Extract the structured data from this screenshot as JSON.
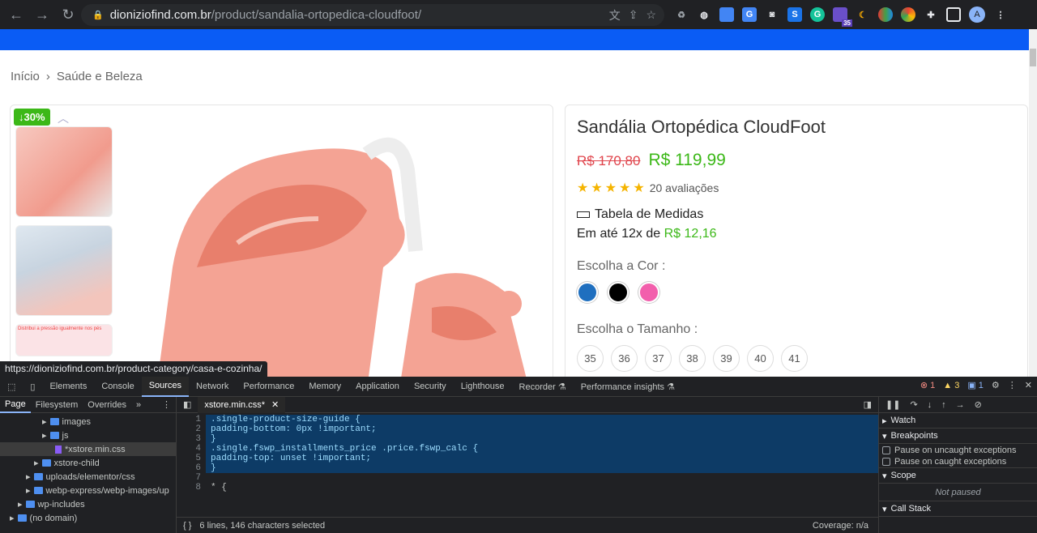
{
  "browser": {
    "url_host": "dioniziofind.com.br",
    "url_path": "/product/sandalia-ortopedica-cloudfoot/",
    "ext_badge": "35",
    "avatar_letter": "A"
  },
  "breadcrumb": {
    "home": "Início",
    "category": "Saúde e Beleza"
  },
  "gallery": {
    "discount": "↓30%",
    "thumb_caption": "Distribui a pressão igualmente nos pés"
  },
  "product": {
    "title": "Sandália Ortopédica CloudFoot",
    "old_price": "R$ 170,80",
    "new_price": "R$ 119,99",
    "reviews": "20 avaliações",
    "rating": 5,
    "size_guide": "Tabela de Medidas",
    "installments_prefix": "Em até 12x de ",
    "installments_value": "R$ 12,16",
    "color_label": "Escolha a Cor :",
    "colors": [
      "#1f6fbf",
      "#000000",
      "#f25fac"
    ],
    "size_label": "Escolha o Tamanho :",
    "sizes": [
      "35",
      "36",
      "37",
      "38",
      "39",
      "40",
      "41"
    ]
  },
  "status_url": "https://dioniziofind.com.br/product-category/casa-e-cozinha/",
  "devtools": {
    "tabs": [
      "Elements",
      "Console",
      "Sources",
      "Network",
      "Performance",
      "Memory",
      "Application",
      "Security",
      "Lighthouse",
      "Recorder ⚗",
      "Performance insights ⚗"
    ],
    "active_tab": "Sources",
    "errors": "1",
    "warnings": "3",
    "infos": "1",
    "left_tabs": [
      "Page",
      "Filesystem",
      "Overrides"
    ],
    "tree": [
      {
        "label": "images",
        "type": "folder",
        "indent": 52
      },
      {
        "label": "js",
        "type": "folder",
        "indent": 52
      },
      {
        "label": "*xstore.min.css",
        "type": "file",
        "indent": 64,
        "selected": true
      },
      {
        "label": "xstore-child",
        "type": "folder",
        "indent": 42
      },
      {
        "label": "uploads/elementor/css",
        "type": "folder",
        "indent": 32
      },
      {
        "label": "webp-express/webp-images/up",
        "type": "folder",
        "indent": 32
      },
      {
        "label": "wp-includes",
        "type": "folder",
        "indent": 22
      },
      {
        "label": "(no domain)",
        "type": "folder",
        "indent": 12
      }
    ],
    "editor_tab": "xstore.min.css*",
    "code": [
      {
        "n": "1",
        "text": ".single-product-size-guide {",
        "hl": true
      },
      {
        "n": "2",
        "text": "padding-bottom: 0px !important;",
        "hl": true
      },
      {
        "n": "3",
        "text": "}",
        "hl": true
      },
      {
        "n": "4",
        "text": ".single.fswp_installments_price .price.fswp_calc {",
        "hl": true
      },
      {
        "n": "5",
        "text": "padding-top: unset !important;",
        "hl": true
      },
      {
        "n": "6",
        "text": "}",
        "hl": true
      },
      {
        "n": "7",
        "text": "",
        "hl": false
      },
      {
        "n": "8",
        "text": "* {",
        "hl": false
      }
    ],
    "status_left": "6 lines, 146 characters selected",
    "status_right": "Coverage: n/a",
    "right_sections": {
      "watch": "Watch",
      "breakpoints": "Breakpoints",
      "uncaught": "Pause on uncaught exceptions",
      "caught": "Pause on caught exceptions",
      "scope": "Scope",
      "not_paused": "Not paused",
      "callstack": "Call Stack"
    }
  }
}
